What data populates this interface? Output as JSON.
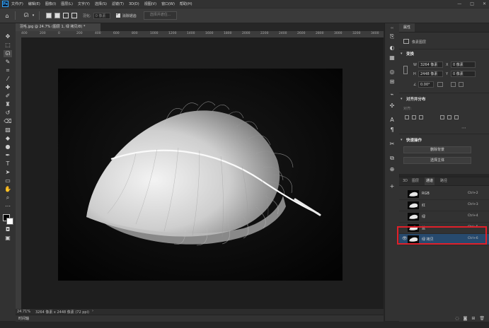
{
  "menu": {
    "logo": "Ps",
    "items": [
      "文件(F)",
      "编辑(E)",
      "图像(I)",
      "图层(L)",
      "文字(Y)",
      "选择(S)",
      "滤镜(T)",
      "3D(D)",
      "视图(V)",
      "窗口(W)",
      "帮助(H)"
    ],
    "window_controls": [
      "—",
      "□",
      "✕"
    ]
  },
  "options": {
    "feather_label": "羽化:",
    "feather_value": "0 像素",
    "antialias_label": "消除锯齿",
    "select_subject": "选择并遮住..."
  },
  "document": {
    "tab_title": "羽毛.jpg @ 24.7% (图层 1, 绿 拷贝/8) *",
    "zoom": "24.71%",
    "doc_info": "3264 像素 x 2448 像素 (72 ppi)",
    "ruler_ticks": [
      "400",
      "200",
      "0",
      "200",
      "400",
      "600",
      "800",
      "1000",
      "1200",
      "1400",
      "1600",
      "1800",
      "2000",
      "2200",
      "2400",
      "2600",
      "2800",
      "3000",
      "3200",
      "3400"
    ]
  },
  "timeline_label": "时间轴",
  "properties": {
    "tab": "属性",
    "type_label": "像素图层",
    "transform_title": "变换",
    "w_label": "W",
    "w_value": "3264 像素",
    "x_label": "X",
    "x_value": "0 像素",
    "h_label": "H",
    "h_value": "2448 像素",
    "y_label": "Y",
    "y_value": "0 像素",
    "angle_value": "0.00°",
    "align_title": "对齐并分布",
    "align_sub": "对齐:",
    "quick_title": "快速操作",
    "remove_bg": "删除背景",
    "select_subject": "选择主体"
  },
  "channels_panel": {
    "tabs": [
      "3D",
      "图层",
      "通道",
      "路径"
    ],
    "active_tab": "通道",
    "rows": [
      {
        "name": "RGB",
        "shortcut": "Ctrl+2",
        "selected": false,
        "visible": false
      },
      {
        "name": "红",
        "shortcut": "Ctrl+3",
        "selected": false,
        "visible": false
      },
      {
        "name": "绿",
        "shortcut": "Ctrl+4",
        "selected": false,
        "visible": false
      },
      {
        "name": "蓝",
        "shortcut": "Ctrl+5",
        "selected": false,
        "visible": false
      },
      {
        "name": "绿 拷贝",
        "shortcut": "Ctrl+6",
        "selected": true,
        "visible": true
      }
    ]
  },
  "colors": {
    "accent": "#31a8ff",
    "selection": "#274a6e",
    "highlight": "#e0202a"
  }
}
